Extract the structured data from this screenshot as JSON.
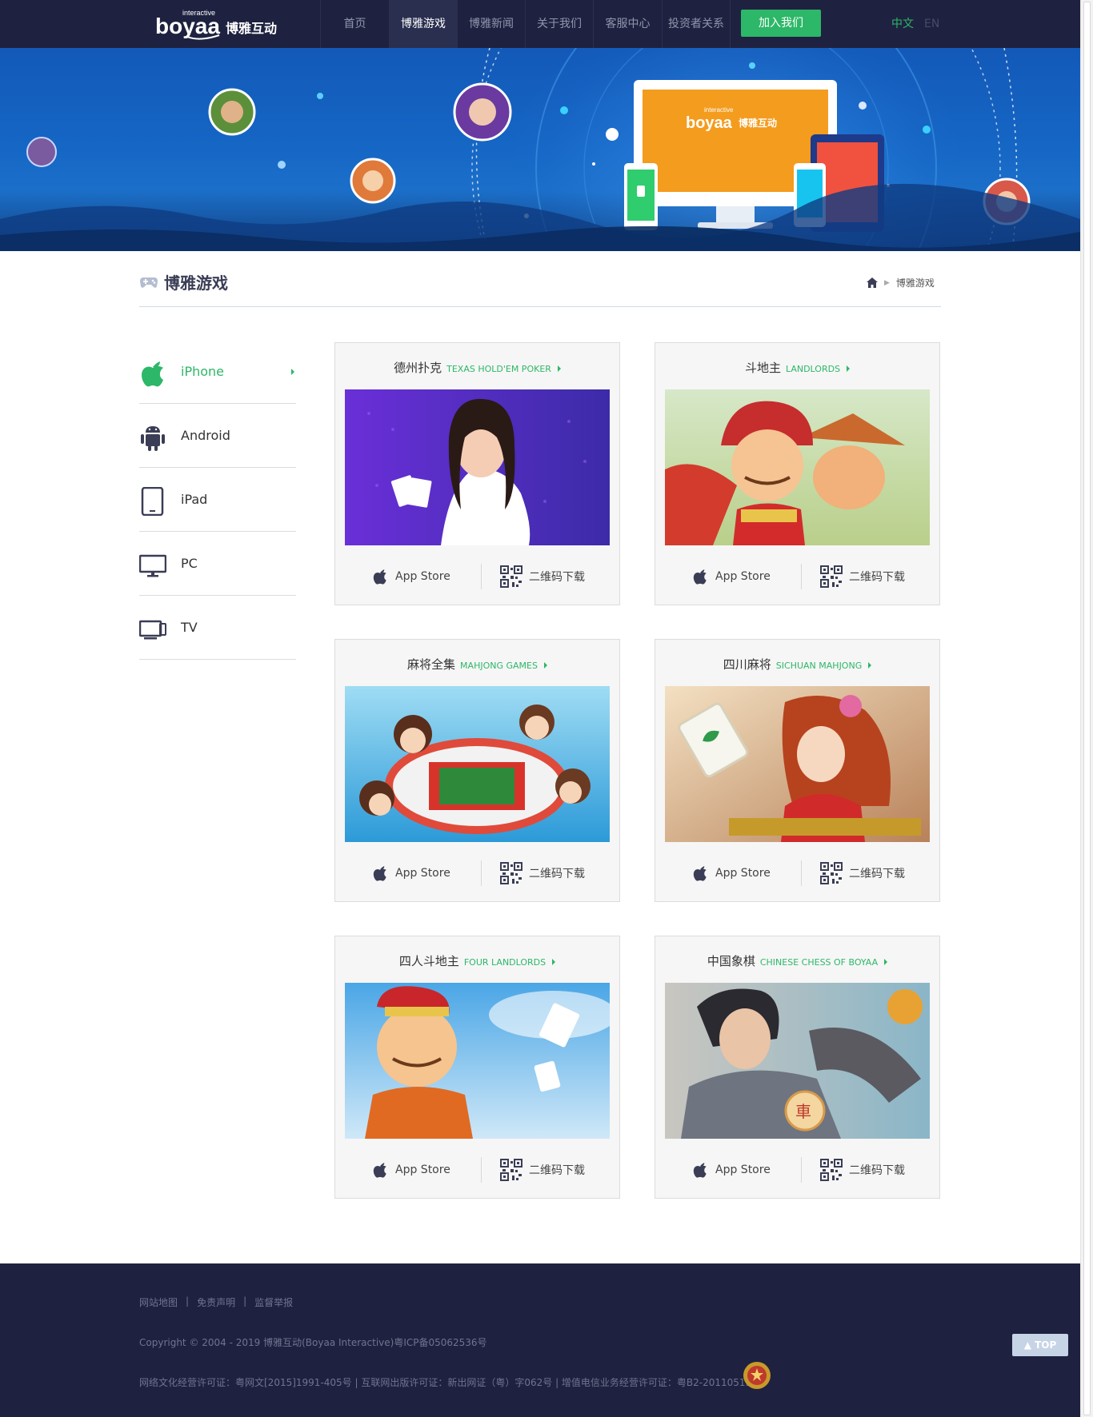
{
  "header": {
    "logo_text": "boyaa",
    "logo_sub": "interactive",
    "logo_cn": "博雅互动",
    "nav": [
      {
        "label": "首页"
      },
      {
        "label": "博雅游戏"
      },
      {
        "label": "博雅新闻"
      },
      {
        "label": "关于我们"
      },
      {
        "label": "客服中心"
      },
      {
        "label": "投资者关系"
      }
    ],
    "join_label": "加入我们",
    "lang_zh": "中文",
    "lang_en": "EN"
  },
  "banner": {
    "screen_logo_sub": "interactive",
    "screen_logo": "boyaa",
    "screen_logo_cn": "博雅互动"
  },
  "section": {
    "title": "博雅游戏",
    "breadcrumb_current": "博雅游戏"
  },
  "sidebar": {
    "items": [
      {
        "label": "iPhone",
        "icon": "apple-icon"
      },
      {
        "label": "Android",
        "icon": "android-icon"
      },
      {
        "label": "iPad",
        "icon": "tablet-icon"
      },
      {
        "label": "PC",
        "icon": "monitor-icon"
      },
      {
        "label": "TV",
        "icon": "tv-icon"
      }
    ]
  },
  "games": [
    {
      "cn": "德州扑克",
      "en": "TEXAS HOLD'EM POKER"
    },
    {
      "cn": "斗地主",
      "en": "LANDLORDS"
    },
    {
      "cn": "麻将全集",
      "en": "MAHJONG GAMES"
    },
    {
      "cn": "四川麻将",
      "en": "SICHUAN MAHJONG"
    },
    {
      "cn": "四人斗地主",
      "en": "FOUR LANDLORDS"
    },
    {
      "cn": "中国象棋",
      "en": "CHINESE CHESS OF BOYAA"
    }
  ],
  "card_actions": {
    "appstore": "App Store",
    "qr": "二维码下载"
  },
  "footer": {
    "links": [
      "网站地图",
      "免责声明",
      "监督举报"
    ],
    "copyright": "Copyright © 2004 - 2019 博雅互动(Boyaa Interactive)粤ICP备05062536号",
    "license": "网络文化经营许可证：粤网文[2015]1991-405号 | 互联网出版许可证：新出网证（粤）字062号 | 增值电信业务经营许可证：粤B2-20110513"
  },
  "top_label": "TOP"
}
